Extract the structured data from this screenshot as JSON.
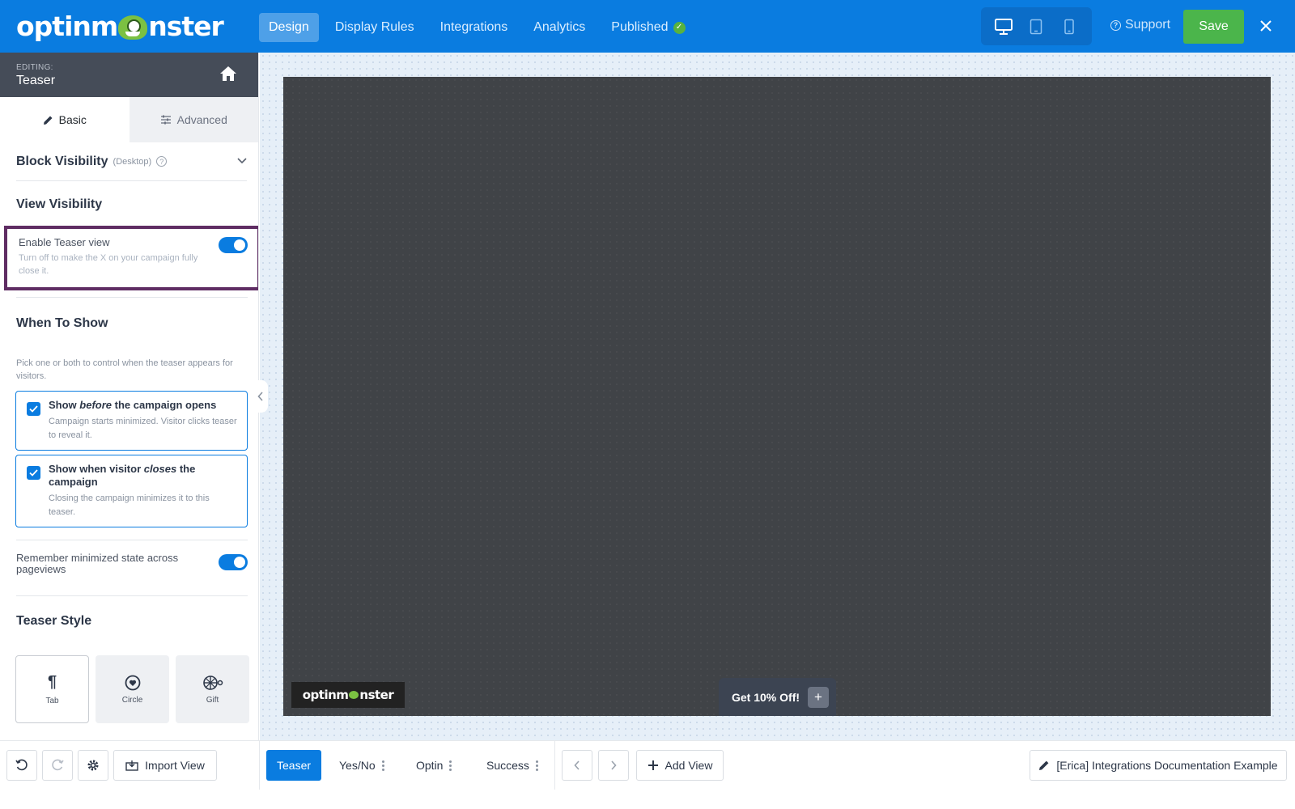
{
  "header": {
    "logo_text": "optinmonster",
    "nav": [
      {
        "label": "Design"
      },
      {
        "label": "Display Rules"
      },
      {
        "label": "Integrations"
      },
      {
        "label": "Analytics"
      },
      {
        "label": "Published"
      }
    ],
    "support_label": "Support",
    "save_label": "Save",
    "colors": {
      "bar": "#0a7ce0",
      "save": "#4bb54b",
      "published_check": "#58b23e"
    }
  },
  "sidebar": {
    "editing_label": "EDITING:",
    "editing_name": "Teaser",
    "tabs": [
      {
        "label": "Basic"
      },
      {
        "label": "Advanced"
      }
    ],
    "block_visibility": {
      "title": "Block Visibility",
      "subtitle": "(Desktop)"
    },
    "view_visibility_title": "View Visibility",
    "enable_teaser": {
      "label": "Enable Teaser view",
      "description": "Turn off to make the X on your campaign fully close it.",
      "enabled": true
    },
    "when_to_show": {
      "title": "When To Show",
      "description": "Pick one or both to control when the teaser appears for visitors.",
      "options": [
        {
          "title_pre": "Show ",
          "title_em": "before",
          "title_post": " the campaign opens",
          "description": "Campaign starts minimized. Visitor clicks teaser to reveal it.",
          "checked": true
        },
        {
          "title_pre": "Show when visitor ",
          "title_em": "closes",
          "title_post": " the campaign",
          "description": "Closing the campaign minimizes it to this teaser.",
          "checked": true
        }
      ]
    },
    "remember_state": {
      "label": "Remember minimized state across pageviews",
      "enabled": true
    },
    "teaser_style": {
      "title": "Teaser Style",
      "options": [
        {
          "label": "Tab",
          "selected": true
        },
        {
          "label": "Circle",
          "selected": false
        },
        {
          "label": "Gift",
          "selected": false
        }
      ]
    }
  },
  "canvas": {
    "logo_text": "optinmonster",
    "teaser_text": "Get 10% Off!",
    "teaser_plus": "+"
  },
  "bottom": {
    "import_label": "Import View",
    "views": [
      {
        "label": "Teaser",
        "active": true
      },
      {
        "label": "Yes/No",
        "active": false
      },
      {
        "label": "Optin",
        "active": false
      },
      {
        "label": "Success",
        "active": false
      }
    ],
    "add_view_label": "Add View",
    "campaign_name": "[Erica] Integrations Documentation Example"
  }
}
